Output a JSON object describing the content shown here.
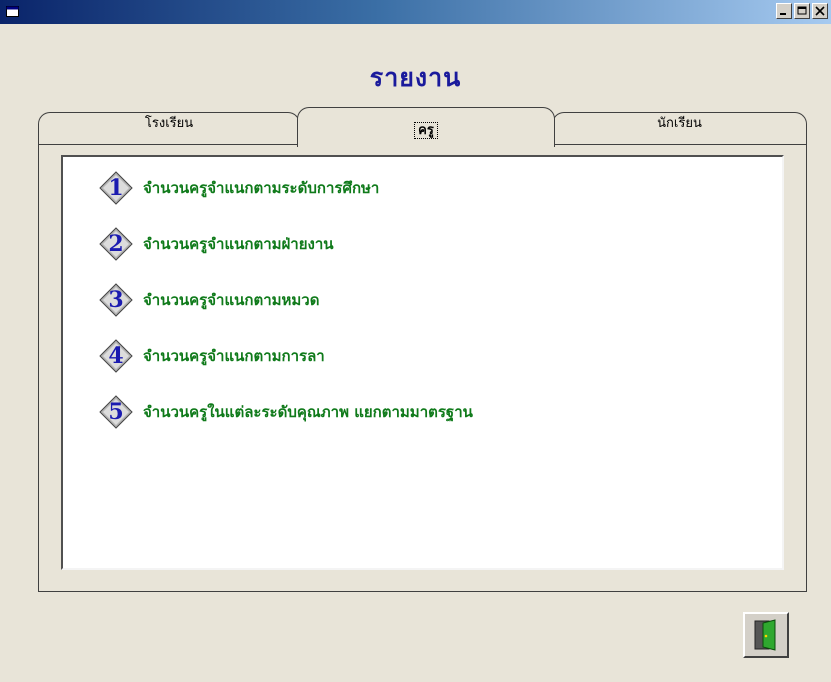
{
  "window": {
    "title": "",
    "controls": {
      "minimize": "_",
      "maximize": "□",
      "close": "×"
    }
  },
  "page_title": "รายงาน",
  "tabs": [
    {
      "label": "โรงเรียน",
      "active": false
    },
    {
      "label": "ครู",
      "active": true
    },
    {
      "label": "นักเรียน",
      "active": false
    }
  ],
  "report_items": [
    {
      "number": "1",
      "label": "จำนวนครูจำแนกตามระดับการศึกษา"
    },
    {
      "number": "2",
      "label": "จำนวนครูจำแนกตามฝ่ายงาน"
    },
    {
      "number": "3",
      "label": "จำนวนครูจำแนกตามหมวด"
    },
    {
      "number": "4",
      "label": "จำนวนครูจำแนกตามการลา"
    },
    {
      "number": "5",
      "label": "จำนวนครูในแต่ละระดับคุณภาพ แยกตามมาตรฐาน"
    }
  ],
  "icons": {
    "app": "window-icon",
    "exit": "exit-door-icon",
    "item": "diamond-number-icon"
  },
  "colors": {
    "title": "#1a1a9c",
    "item_text": "#0f7a1a",
    "number": "#1b1bb0",
    "titlebar": "#0a246a"
  }
}
